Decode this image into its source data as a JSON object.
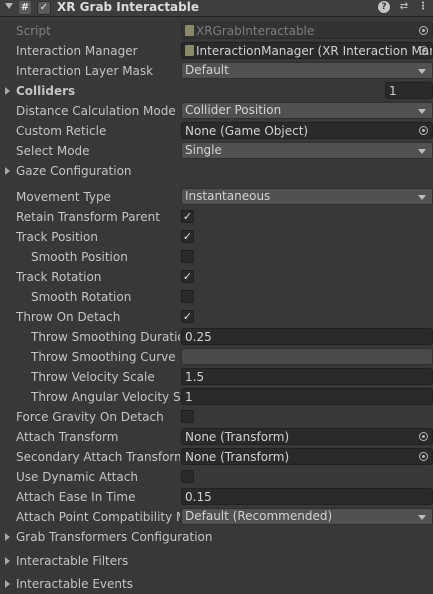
{
  "header": {
    "title": "XR Grab Interactable",
    "enabled": "✓",
    "script_icon": "#",
    "icons": [
      "help-icon",
      "preset-icon",
      "more-options-icon"
    ]
  },
  "fields": {
    "script": {
      "label": "Script",
      "value": "XRGrabInteractable"
    },
    "interaction_manager": {
      "label": "Interaction Manager",
      "value": "InteractionManager (XR Interaction Manager)"
    },
    "interaction_layer_mask": {
      "label": "Interaction Layer Mask",
      "value": "Default"
    },
    "colliders": {
      "label": "Colliders",
      "value": "1"
    },
    "distance_calc_mode": {
      "label": "Distance Calculation Mode",
      "value": "Collider Position"
    },
    "custom_reticle": {
      "label": "Custom Reticle",
      "value": "None (Game Object)"
    },
    "select_mode": {
      "label": "Select Mode",
      "value": "Single"
    },
    "gaze_configuration": {
      "label": "Gaze Configuration"
    },
    "movement_type": {
      "label": "Movement Type",
      "value": "Instantaneous"
    },
    "retain_transform_parent": {
      "label": "Retain Transform Parent",
      "checked": true
    },
    "track_position": {
      "label": "Track Position",
      "checked": true
    },
    "smooth_position": {
      "label": "Smooth Position",
      "checked": false
    },
    "track_rotation": {
      "label": "Track Rotation",
      "checked": true
    },
    "smooth_rotation": {
      "label": "Smooth Rotation",
      "checked": false
    },
    "throw_on_detach": {
      "label": "Throw On Detach",
      "checked": true
    },
    "throw_smoothing_duration": {
      "label": "Throw Smoothing Duration",
      "value": "0.25"
    },
    "throw_smoothing_curve": {
      "label": "Throw Smoothing Curve"
    },
    "throw_velocity_scale": {
      "label": "Throw Velocity Scale",
      "value": "1.5"
    },
    "throw_angular_velocity_scale": {
      "label": "Throw Angular Velocity Scale",
      "value": "1"
    },
    "force_gravity_on_detach": {
      "label": "Force Gravity On Detach",
      "checked": false
    },
    "attach_transform": {
      "label": "Attach Transform",
      "value": "None (Transform)"
    },
    "secondary_attach_transform": {
      "label": "Secondary Attach Transform",
      "value": "None (Transform)"
    },
    "use_dynamic_attach": {
      "label": "Use Dynamic Attach",
      "checked": false
    },
    "attach_ease_in_time": {
      "label": "Attach Ease In Time",
      "value": "0.15"
    },
    "attach_point_compat_mode": {
      "label": "Attach Point Compatibility Mode",
      "value": "Default (Recommended)"
    },
    "grab_transformers_configuration": {
      "label": "Grab Transformers Configuration"
    },
    "interactable_filters": {
      "label": "Interactable Filters"
    },
    "interactable_events": {
      "label": "Interactable Events"
    }
  },
  "check_glyph": "✓"
}
